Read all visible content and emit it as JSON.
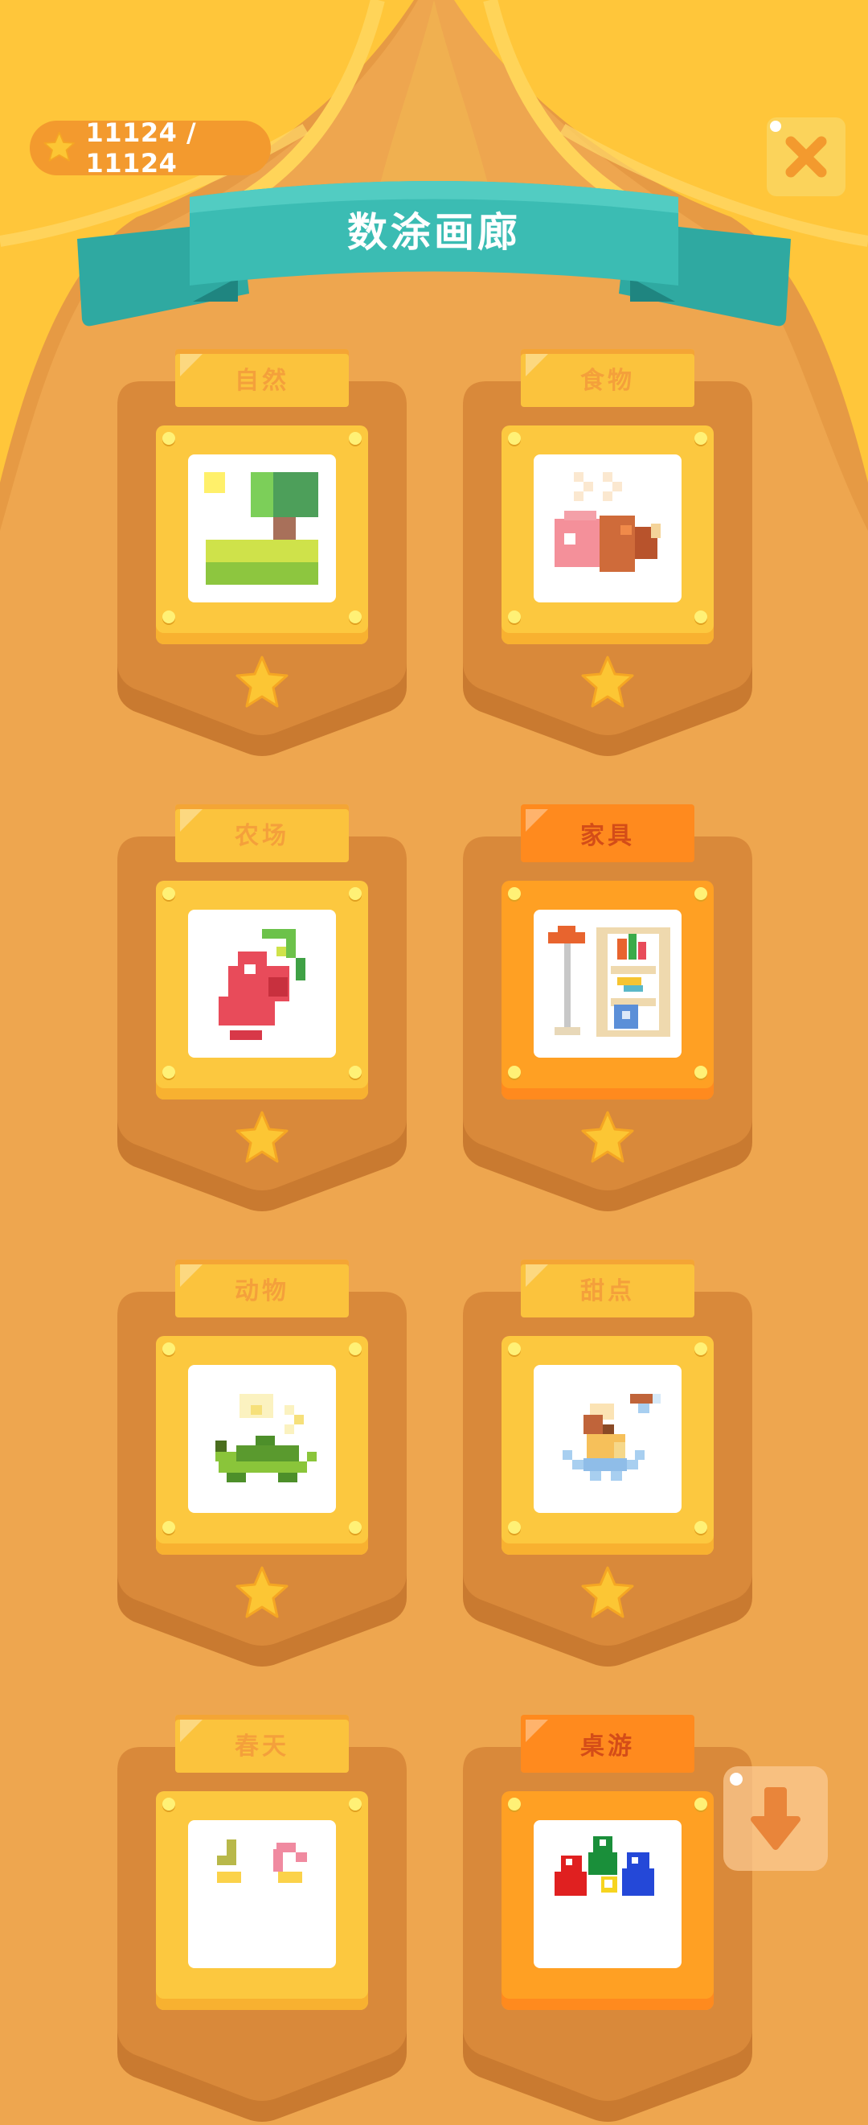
{
  "header": {
    "coins_text": "11124 / 11124",
    "title": "数涂画廊"
  },
  "categories": [
    {
      "label": "自然",
      "highlighted": false,
      "picture": "tree-landscape-icon"
    },
    {
      "label": "食物",
      "highlighted": false,
      "picture": "ham-icon"
    },
    {
      "label": "农场",
      "highlighted": false,
      "picture": "radish-icon"
    },
    {
      "label": "家具",
      "highlighted": true,
      "picture": "bookshelf-lamp-icon"
    },
    {
      "label": "动物",
      "highlighted": false,
      "picture": "turtle-icon"
    },
    {
      "label": "甜点",
      "highlighted": false,
      "picture": "ice-cream-icon"
    },
    {
      "label": "春天",
      "highlighted": false,
      "picture": "spring-icon"
    },
    {
      "label": "桌游",
      "highlighted": true,
      "picture": "board-game-pieces-icon"
    }
  ],
  "colors": {
    "background": "#eea64f",
    "curtain": "#ffc63a",
    "banner": "#3bbcb3",
    "card": "#d9893a",
    "tag": "#fbc33d",
    "tag_highlight": "#ff8a1e",
    "star": "#fcc634"
  }
}
